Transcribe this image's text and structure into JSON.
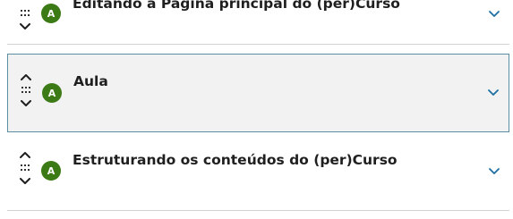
{
  "items": [
    {
      "title": "Editando a Página principal do (per)Curso",
      "avatar": "A",
      "selected": false
    },
    {
      "title": "Aula",
      "avatar": "A",
      "selected": true
    },
    {
      "title": "Estruturando os conteúdos do (per)Curso",
      "avatar": "A",
      "selected": false
    }
  ],
  "colors": {
    "avatar_bg": "#3c7a16",
    "expand_chevron": "#1d6fa3",
    "selected_border": "#5b8ea0",
    "selected_bg": "#f2f2f2"
  },
  "icons": {
    "move_up": "chevron-up-icon",
    "move_down": "chevron-down-icon",
    "drag": "drag-handle-icon",
    "expand": "chevron-down-icon"
  }
}
